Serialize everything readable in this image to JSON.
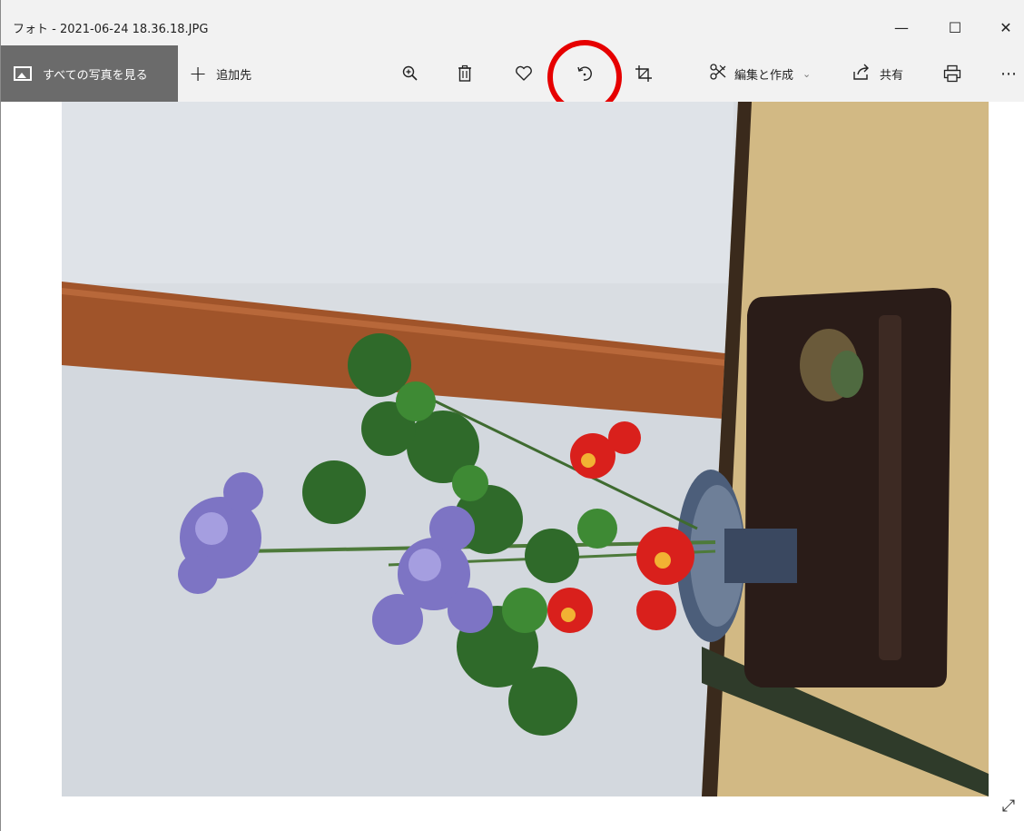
{
  "window": {
    "title": "フォト - 2021-06-24 18.36.18.JPG",
    "minimize_icon": "minimize-icon",
    "maximize_icon": "maximize-icon",
    "close_icon": "close-icon"
  },
  "toolbar": {
    "all_photos_label": "すべての写真を見る",
    "add_to_label": "追加先",
    "edit_create_label": "編集と作成",
    "share_label": "共有",
    "icons": [
      "zoom-in-icon",
      "delete-icon",
      "heart-icon",
      "rotate-icon",
      "crop-icon",
      "edit-icon",
      "share-icon",
      "print-icon",
      "more-icon"
    ]
  },
  "annotation": {
    "highlight_color": "#e60000",
    "highlighted_control": "rotate-icon"
  },
  "photo": {
    "subject": "ikebana-flower-arrangement"
  }
}
